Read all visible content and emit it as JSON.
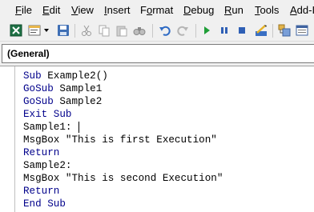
{
  "menu": [
    {
      "label": "File",
      "accel": "F",
      "rest": "ile"
    },
    {
      "label": "Edit",
      "accel": "E",
      "rest": "dit"
    },
    {
      "label": "View",
      "accel": "V",
      "rest": "iew"
    },
    {
      "label": "Insert",
      "accel": "I",
      "rest": "nsert"
    },
    {
      "label": "Format",
      "accel": "o",
      "pre": "F",
      "rest": "rmat"
    },
    {
      "label": "Debug",
      "accel": "D",
      "rest": "ebug"
    },
    {
      "label": "Run",
      "accel": "R",
      "rest": "un"
    },
    {
      "label": "Tools",
      "accel": "T",
      "rest": "ools"
    },
    {
      "label": "Add-I",
      "accel": "A",
      "rest": "dd-I"
    }
  ],
  "toolbar": {
    "icons": [
      "excel-icon",
      "insert-module-icon",
      "dropdown-arrow-icon",
      "save-icon",
      "cut-icon",
      "copy-icon",
      "paste-icon",
      "find-icon",
      "undo-icon",
      "redo-icon",
      "run-icon",
      "break-icon",
      "reset-icon",
      "design-mode-icon",
      "project-explorer-icon",
      "properties-icon"
    ]
  },
  "general_dropdown": {
    "value": "(General)"
  },
  "code": {
    "lines": [
      {
        "kw": "Sub",
        "text": " Example2()"
      },
      {
        "kw": "GoSub",
        "text": " Sample1"
      },
      {
        "kw": "GoSub",
        "text": " Sample2"
      },
      {
        "kw": "Exit Sub",
        "text": ""
      },
      {
        "kw": "",
        "text": "Sample1:"
      },
      {
        "kw": "",
        "text": "MsgBox \"This is first Execution\""
      },
      {
        "kw": "Return",
        "text": ""
      },
      {
        "kw": "",
        "text": "Sample2:"
      },
      {
        "kw": "",
        "text": "MsgBox \"This is second Execution\""
      },
      {
        "kw": "Return",
        "text": ""
      },
      {
        "kw": "End Sub",
        "text": ""
      }
    ]
  },
  "colors": {
    "keyword": "#00008b",
    "background": "#f0f0f0"
  }
}
